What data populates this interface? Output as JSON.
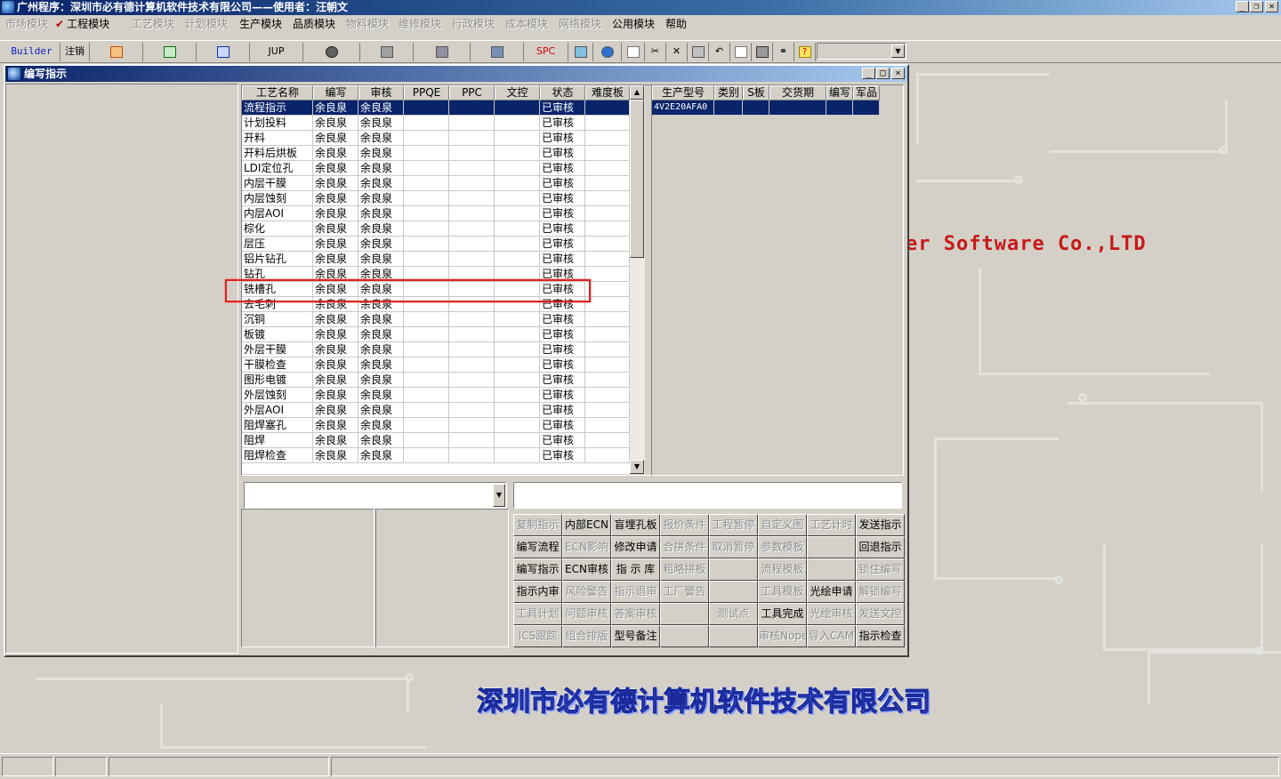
{
  "window": {
    "title": "广州程序：深圳市必有德计算机软件技术有限公司——使用者：汪朝文",
    "controls": [
      "_",
      "❐",
      "×"
    ]
  },
  "menu": [
    {
      "label": "市场模块",
      "enabled": false
    },
    {
      "label": "工程模块",
      "enabled": true,
      "checked": true
    },
    {
      "label": "工艺模块",
      "enabled": false
    },
    {
      "label": "计划模块",
      "enabled": false
    },
    {
      "label": "生产模块",
      "enabled": true
    },
    {
      "label": "品质模块",
      "enabled": true
    },
    {
      "label": "物料模块",
      "enabled": false
    },
    {
      "label": "维修模块",
      "enabled": false
    },
    {
      "label": "行政模块",
      "enabled": false
    },
    {
      "label": "成本模块",
      "enabled": false
    },
    {
      "label": "网络模块",
      "enabled": false
    },
    {
      "label": "公用模块",
      "enabled": true
    },
    {
      "label": "帮助",
      "enabled": true
    }
  ],
  "toolbar": {
    "builder": "Builder",
    "logout": "注销",
    "jup": "JUP",
    "spc": "SPC",
    "combo_value": ""
  },
  "child_window": {
    "title": "编写指示",
    "controls": [
      "_",
      "□",
      "×"
    ]
  },
  "process_grid": {
    "columns": [
      "工艺名称",
      "编写",
      "审核",
      "PPQE",
      "PPC",
      "文控",
      "状态",
      "难度板"
    ],
    "rows": [
      [
        "流程指示",
        "余良泉",
        "余良泉",
        "",
        "",
        "",
        "已审核",
        ""
      ],
      [
        "计划投料",
        "余良泉",
        "余良泉",
        "",
        "",
        "",
        "已审核",
        ""
      ],
      [
        "开料",
        "余良泉",
        "余良泉",
        "",
        "",
        "",
        "已审核",
        ""
      ],
      [
        "开料后烘板",
        "余良泉",
        "余良泉",
        "",
        "",
        "",
        "已审核",
        ""
      ],
      [
        "LDI定位孔",
        "余良泉",
        "余良泉",
        "",
        "",
        "",
        "已审核",
        ""
      ],
      [
        "内层干膜",
        "余良泉",
        "余良泉",
        "",
        "",
        "",
        "已审核",
        ""
      ],
      [
        "内层蚀刻",
        "余良泉",
        "余良泉",
        "",
        "",
        "",
        "已审核",
        ""
      ],
      [
        "内层AOI",
        "余良泉",
        "余良泉",
        "",
        "",
        "",
        "已审核",
        ""
      ],
      [
        "棕化",
        "余良泉",
        "余良泉",
        "",
        "",
        "",
        "已审核",
        ""
      ],
      [
        "层压",
        "余良泉",
        "余良泉",
        "",
        "",
        "",
        "已审核",
        ""
      ],
      [
        "铝片钻孔",
        "余良泉",
        "余良泉",
        "",
        "",
        "",
        "已审核",
        ""
      ],
      [
        "钻孔",
        "余良泉",
        "余良泉",
        "",
        "",
        "",
        "已审核",
        ""
      ],
      [
        "铣槽孔",
        "余良泉",
        "余良泉",
        "",
        "",
        "",
        "已审核",
        ""
      ],
      [
        "去毛刺",
        "余良泉",
        "余良泉",
        "",
        "",
        "",
        "已审核",
        ""
      ],
      [
        "沉铜",
        "余良泉",
        "余良泉",
        "",
        "",
        "",
        "已审核",
        ""
      ],
      [
        "板镀",
        "余良泉",
        "余良泉",
        "",
        "",
        "",
        "已审核",
        ""
      ],
      [
        "外层干膜",
        "余良泉",
        "余良泉",
        "",
        "",
        "",
        "已审核",
        ""
      ],
      [
        "干膜检查",
        "余良泉",
        "余良泉",
        "",
        "",
        "",
        "已审核",
        ""
      ],
      [
        "图形电镀",
        "余良泉",
        "余良泉",
        "",
        "",
        "",
        "已审核",
        ""
      ],
      [
        "外层蚀刻",
        "余良泉",
        "余良泉",
        "",
        "",
        "",
        "已审核",
        ""
      ],
      [
        "外层AOI",
        "余良泉",
        "余良泉",
        "",
        "",
        "",
        "已审核",
        ""
      ],
      [
        "阻焊塞孔",
        "余良泉",
        "余良泉",
        "",
        "",
        "",
        "已审核",
        ""
      ],
      [
        "阻焊",
        "余良泉",
        "余良泉",
        "",
        "",
        "",
        "已审核",
        ""
      ],
      [
        "阻焊检查",
        "余良泉",
        "余良泉",
        "",
        "",
        "",
        "已审核",
        ""
      ]
    ],
    "selected_row": 0,
    "highlighted_row": 12
  },
  "model_grid": {
    "columns": [
      "生产型号",
      "类别",
      "S板",
      "交货期",
      "编写",
      "军品"
    ],
    "rows": [
      [
        "4V2E20AFA0",
        "",
        "",
        "",
        "",
        ""
      ]
    ],
    "selected_row": 0
  },
  "left_combo_value": "",
  "right_text_value": "",
  "actions": [
    [
      {
        "label": "复制指示",
        "enabled": false
      },
      {
        "label": "内部ECN",
        "enabled": true
      },
      {
        "label": "盲埋孔板",
        "enabled": true
      },
      {
        "label": "报价条件",
        "enabled": false
      },
      {
        "label": "工程暂停",
        "enabled": false
      },
      {
        "label": "自定义图",
        "enabled": false
      },
      {
        "label": "工艺计时",
        "enabled": false
      },
      {
        "label": "发送指示",
        "enabled": true
      }
    ],
    [
      {
        "label": "编写流程",
        "enabled": true
      },
      {
        "label": "ECN影响",
        "enabled": false
      },
      {
        "label": "修改申请",
        "enabled": true
      },
      {
        "label": "合拼条件",
        "enabled": false
      },
      {
        "label": "取消暂停",
        "enabled": false
      },
      {
        "label": "参数模板",
        "enabled": false
      },
      {
        "label": "",
        "enabled": false
      },
      {
        "label": "回退指示",
        "enabled": true
      }
    ],
    [
      {
        "label": "编写指示",
        "enabled": true
      },
      {
        "label": "ECN审核",
        "enabled": true
      },
      {
        "label": "指 示 库",
        "enabled": true
      },
      {
        "label": "粗略拼板",
        "enabled": false
      },
      {
        "label": "",
        "enabled": false
      },
      {
        "label": "流程模板",
        "enabled": false
      },
      {
        "label": "",
        "enabled": false
      },
      {
        "label": "锁住编写",
        "enabled": false
      }
    ],
    [
      {
        "label": "指示内审",
        "enabled": true
      },
      {
        "label": "风险警告",
        "enabled": false
      },
      {
        "label": "指示退审",
        "enabled": false
      },
      {
        "label": "工厂警告",
        "enabled": false
      },
      {
        "label": "",
        "enabled": false
      },
      {
        "label": "工具模板",
        "enabled": false
      },
      {
        "label": "光绘申请",
        "enabled": true
      },
      {
        "label": "解锁编写",
        "enabled": false
      }
    ],
    [
      {
        "label": "工具计划",
        "enabled": false
      },
      {
        "label": "问题审核",
        "enabled": false
      },
      {
        "label": "答案审核",
        "enabled": false
      },
      {
        "label": "",
        "enabled": false
      },
      {
        "label": "测试点",
        "enabled": false
      },
      {
        "label": "工具完成",
        "enabled": true
      },
      {
        "label": "光绘审核",
        "enabled": false
      },
      {
        "label": "发送文控",
        "enabled": false
      }
    ],
    [
      {
        "label": "ICS跟踪",
        "enabled": false
      },
      {
        "label": "组合排版",
        "enabled": false
      },
      {
        "label": "型号备注",
        "enabled": true
      },
      {
        "label": "",
        "enabled": false
      },
      {
        "label": "",
        "enabled": false
      },
      {
        "label": "审核Nope",
        "enabled": false
      },
      {
        "label": "导入CAM",
        "enabled": false
      },
      {
        "label": "指示检查",
        "enabled": true
      }
    ]
  ],
  "watermark": {
    "english": "er Software Co.,LTD",
    "chinese": "深圳市必有德计算机软件技术有限公司"
  },
  "colors": {
    "title_gradient_start": "#0a246a",
    "selection": "#0a246a",
    "highlight_box": "#e02020",
    "watermark_en": "#c81818",
    "watermark_cn": "#5870e8"
  }
}
